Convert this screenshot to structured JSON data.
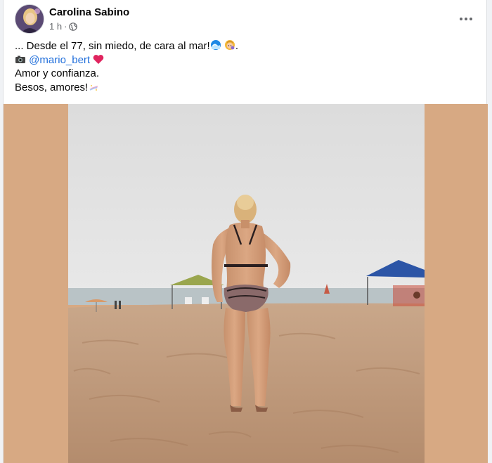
{
  "post": {
    "author_name": "Carolina Sabino",
    "timestamp": "1 h",
    "separator": "·",
    "caption": {
      "line1_text": "... Desde el 77, sin miedo, de cara al mar!",
      "line1_end": ".",
      "line2_mention": "@mario_bert",
      "line3": "Amor y confianza.",
      "line4": "Besos, amores!"
    },
    "icons": {
      "audience": "globe-icon",
      "more": "more-options-icon",
      "camera": "camera-emoji",
      "heart": "red-heart-emoji",
      "wave": "wave-emoji",
      "woman": "woman-emoji",
      "sparkles": "sparkles-emoji"
    },
    "photo_alt": "Woman in bikini standing on a beach facing the sea"
  },
  "colors": {
    "link": "#216fdb",
    "meta_text": "#65676b",
    "media_background": "#d7a983",
    "heart": "#e0245e"
  }
}
